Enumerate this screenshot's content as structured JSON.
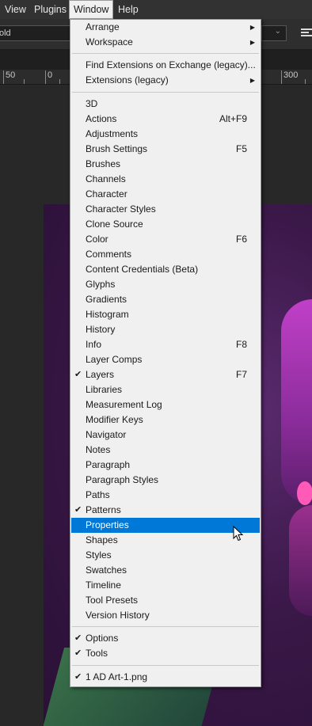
{
  "menubar": {
    "items": [
      "View",
      "Plugins",
      "Window",
      "Help"
    ]
  },
  "options_bar": {
    "font_style_value": "old"
  },
  "ruler": {
    "labels": [
      "50",
      "0",
      "300"
    ]
  },
  "window_menu": {
    "group1": [
      {
        "label": "Arrange",
        "submenu": true
      },
      {
        "label": "Workspace",
        "submenu": true
      }
    ],
    "group2": [
      {
        "label": "Find Extensions on Exchange (legacy)...",
        "submenu": false
      },
      {
        "label": "Extensions (legacy)",
        "submenu": true
      }
    ],
    "group3": [
      {
        "label": "3D",
        "shortcut": ""
      },
      {
        "label": "Actions",
        "shortcut": "Alt+F9"
      },
      {
        "label": "Adjustments",
        "shortcut": ""
      },
      {
        "label": "Brush Settings",
        "shortcut": "F5"
      },
      {
        "label": "Brushes",
        "shortcut": ""
      },
      {
        "label": "Channels",
        "shortcut": ""
      },
      {
        "label": "Character",
        "shortcut": ""
      },
      {
        "label": "Character Styles",
        "shortcut": ""
      },
      {
        "label": "Clone Source",
        "shortcut": ""
      },
      {
        "label": "Color",
        "shortcut": "F6"
      },
      {
        "label": "Comments",
        "shortcut": ""
      },
      {
        "label": "Content Credentials (Beta)",
        "shortcut": ""
      },
      {
        "label": "Glyphs",
        "shortcut": ""
      },
      {
        "label": "Gradients",
        "shortcut": ""
      },
      {
        "label": "Histogram",
        "shortcut": ""
      },
      {
        "label": "History",
        "shortcut": ""
      },
      {
        "label": "Info",
        "shortcut": "F8"
      },
      {
        "label": "Layer Comps",
        "shortcut": ""
      },
      {
        "label": "Layers",
        "shortcut": "F7",
        "checked": true
      },
      {
        "label": "Libraries",
        "shortcut": ""
      },
      {
        "label": "Measurement Log",
        "shortcut": ""
      },
      {
        "label": "Modifier Keys",
        "shortcut": ""
      },
      {
        "label": "Navigator",
        "shortcut": ""
      },
      {
        "label": "Notes",
        "shortcut": ""
      },
      {
        "label": "Paragraph",
        "shortcut": ""
      },
      {
        "label": "Paragraph Styles",
        "shortcut": ""
      },
      {
        "label": "Paths",
        "shortcut": ""
      },
      {
        "label": "Patterns",
        "shortcut": "",
        "checked": true
      },
      {
        "label": "Properties",
        "shortcut": "",
        "highlighted": true
      },
      {
        "label": "Shapes",
        "shortcut": ""
      },
      {
        "label": "Styles",
        "shortcut": ""
      },
      {
        "label": "Swatches",
        "shortcut": ""
      },
      {
        "label": "Timeline",
        "shortcut": ""
      },
      {
        "label": "Tool Presets",
        "shortcut": ""
      },
      {
        "label": "Version History",
        "shortcut": ""
      }
    ],
    "group4": [
      {
        "label": "Options",
        "checked": true
      },
      {
        "label": "Tools",
        "checked": true
      }
    ],
    "group5": [
      {
        "label": "1 AD Art-1.png",
        "checked": true
      }
    ]
  },
  "colors": {
    "menu_bg": "#f0f0f0",
    "highlight": "#0078d7",
    "app_bg": "#282828"
  }
}
